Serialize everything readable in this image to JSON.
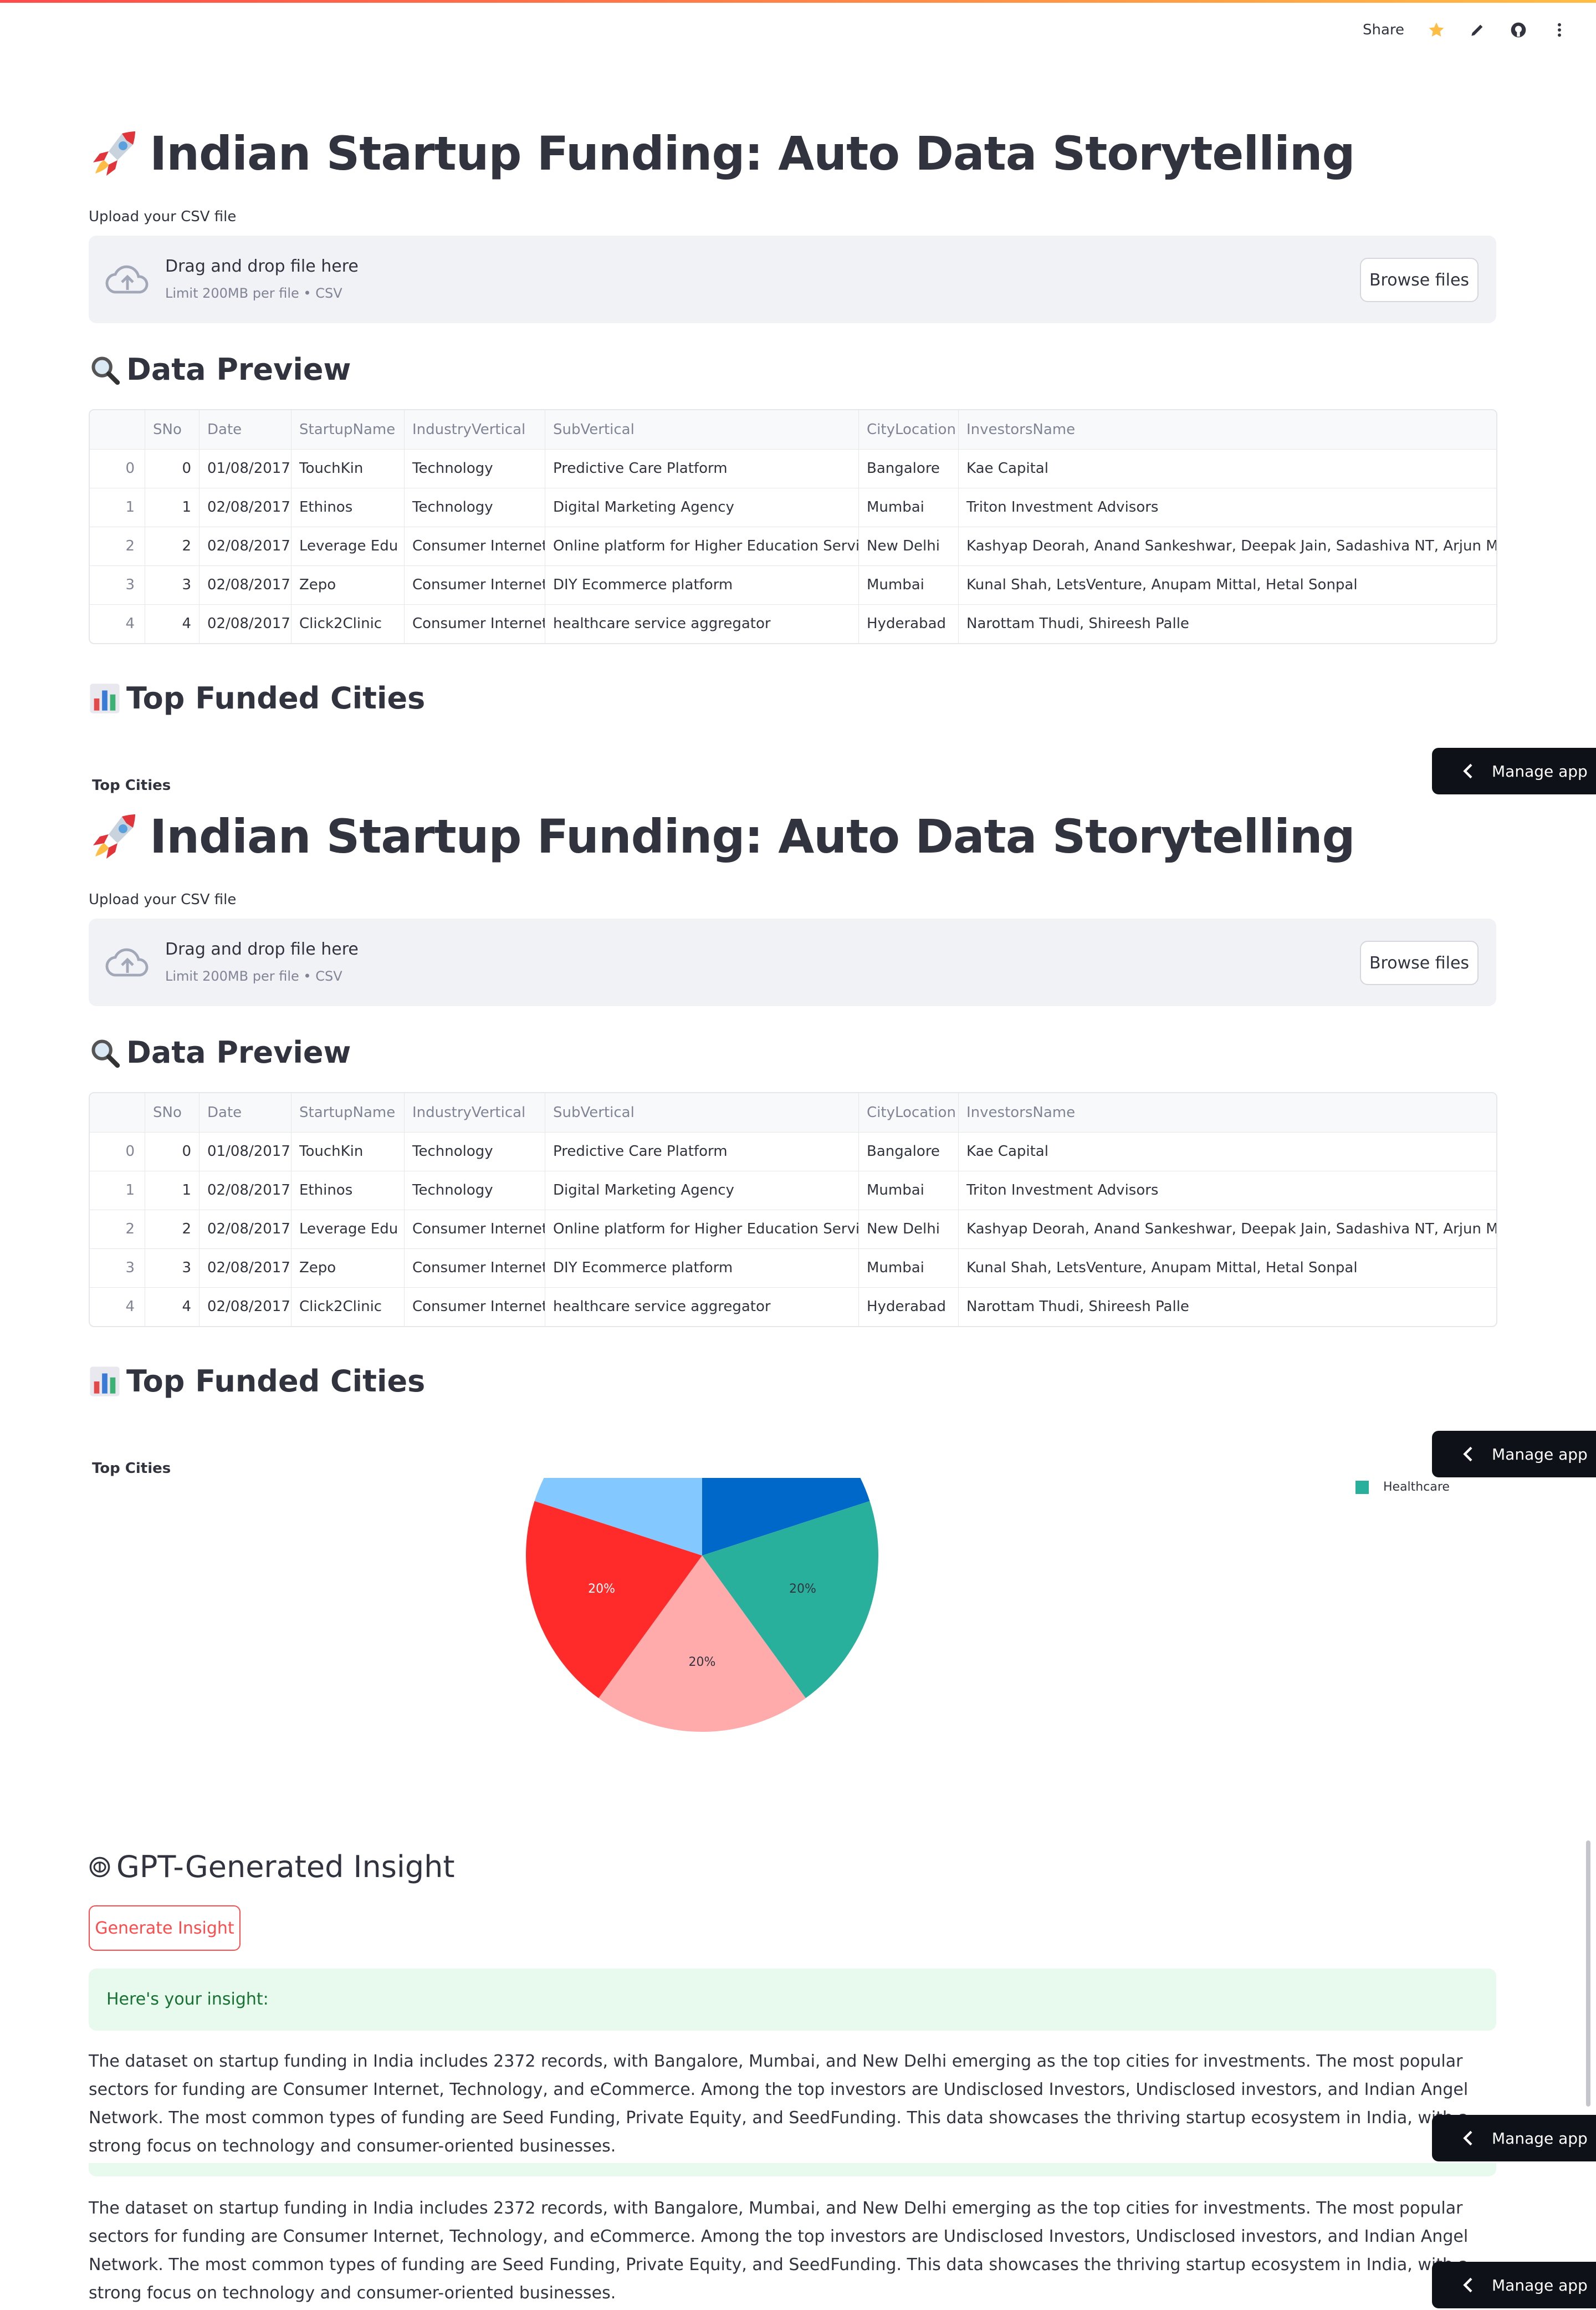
{
  "toolbar": {
    "share": "Share",
    "icons": [
      "star-icon",
      "edit-pencil-icon",
      "github-icon",
      "more-vertical-icon"
    ]
  },
  "app": {
    "title": "Indian Startup Funding: Auto Data Storytelling",
    "upload_label": "Upload your CSV file",
    "dropzone_title": "Drag and drop file here",
    "dropzone_limit": "Limit 200MB per file • CSV",
    "browse_button": "Browse files",
    "preview_heading": "Data Preview",
    "cities_heading": "Top Funded Cities",
    "chart_label": "Top Cities",
    "insight_heading": "GPT-Generated Insight",
    "generate_button": "Generate Insight",
    "success_message": "Here's your insight:",
    "insight_text": "The dataset on startup funding in India includes 2372 records, with Bangalore, Mumbai, and New Delhi emerging as the top cities for investments. The most popular sectors for funding are Consumer Internet, Technology, and eCommerce. Among the top investors are Undisclosed Investors, Undisclosed investors, and Indian Angel Network. The most common types of funding are Seed Funding, Private Equity, and SeedFunding. This data showcases the thriving startup ecosystem in India, with a strong focus on technology and consumer-oriented businesses.",
    "manage_app": "Manage app"
  },
  "table": {
    "columns": [
      "",
      "SNo",
      "Date",
      "StartupName",
      "IndustryVertical",
      "SubVertical",
      "CityLocation",
      "InvestorsName"
    ],
    "rows": [
      [
        "0",
        "0",
        "01/08/2017",
        "TouchKin",
        "Technology",
        "Predictive Care Platform",
        "Bangalore",
        "Kae Capital"
      ],
      [
        "1",
        "1",
        "02/08/2017",
        "Ethinos",
        "Technology",
        "Digital Marketing Agency",
        "Mumbai",
        "Triton Investment Advisors"
      ],
      [
        "2",
        "2",
        "02/08/2017",
        "Leverage Edu",
        "Consumer Internet",
        "Online platform for Higher Education Services",
        "New Delhi",
        "Kashyap Deorah, Anand Sankeshwar, Deepak Jain, Sadashiva NT, Arjun Mehta, Sa"
      ],
      [
        "3",
        "3",
        "02/08/2017",
        "Zepo",
        "Consumer Internet",
        "DIY Ecommerce platform",
        "Mumbai",
        "Kunal Shah, LetsVenture, Anupam Mittal, Hetal Sonpal"
      ],
      [
        "4",
        "4",
        "02/08/2017",
        "Click2Clinic",
        "Consumer Internet",
        "healthcare service aggregator",
        "Hyderabad",
        "Narottam Thudi, Shireesh Palle"
      ]
    ]
  },
  "chart_data": {
    "type": "pie",
    "title": "Top Cities",
    "legend": {
      "placement": "top-right",
      "visible_entries": [
        "Healthcare"
      ]
    },
    "slices": [
      {
        "label": "",
        "value": 20,
        "color": "#0068c9",
        "display": ""
      },
      {
        "label": "Healthcare",
        "value": 20,
        "color": "#29b09d",
        "display": "20%"
      },
      {
        "label": "",
        "value": 20,
        "color": "#ffabab",
        "display": "20%"
      },
      {
        "label": "",
        "value": 20,
        "color": "#ff2b2b",
        "display": "20%"
      },
      {
        "label": "",
        "value": 20,
        "color": "#83c9ff",
        "display": ""
      }
    ]
  },
  "colors": {
    "accent": "#ff4b4b",
    "success_bg": "#e8f9ee",
    "success_text": "#177233",
    "dark": "#0e1117"
  }
}
